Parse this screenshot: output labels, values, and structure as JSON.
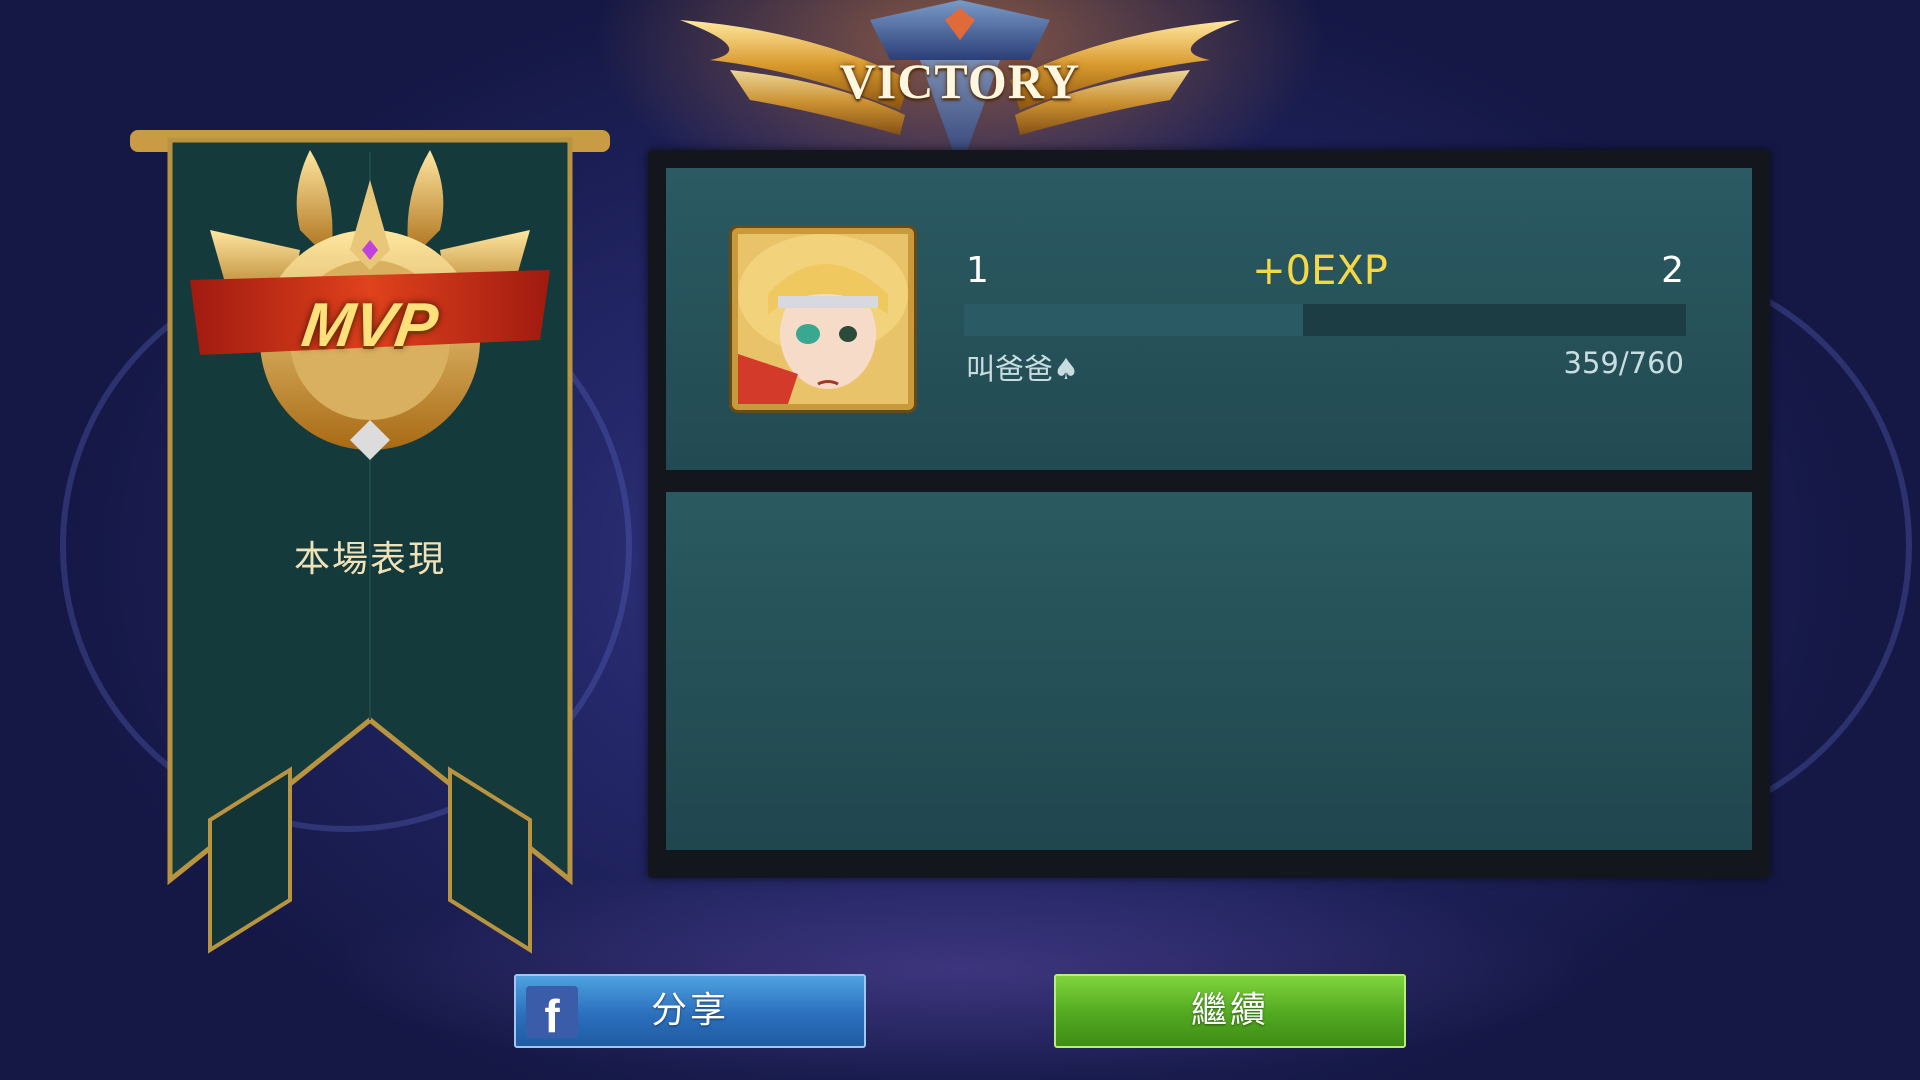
{
  "header": {
    "title": "VICTORY"
  },
  "mvp_banner": {
    "badge_text": "MVP",
    "label": "本場表現"
  },
  "player_card": {
    "level_current": "1",
    "level_next": "2",
    "exp_gain": "+0EXP",
    "player_name": "叫爸爸♠",
    "exp_progress": "359/760",
    "exp_fraction": 0.47,
    "avatar_icon": "hero-portrait-icon"
  },
  "buttons": {
    "share_label": "分享",
    "share_icon": "facebook-icon",
    "continue_label": "繼續"
  },
  "colors": {
    "exp_gain": "#f5d845",
    "share_button": "#2b6fbd",
    "continue_button": "#52a820",
    "panel": "#2b5a62"
  }
}
